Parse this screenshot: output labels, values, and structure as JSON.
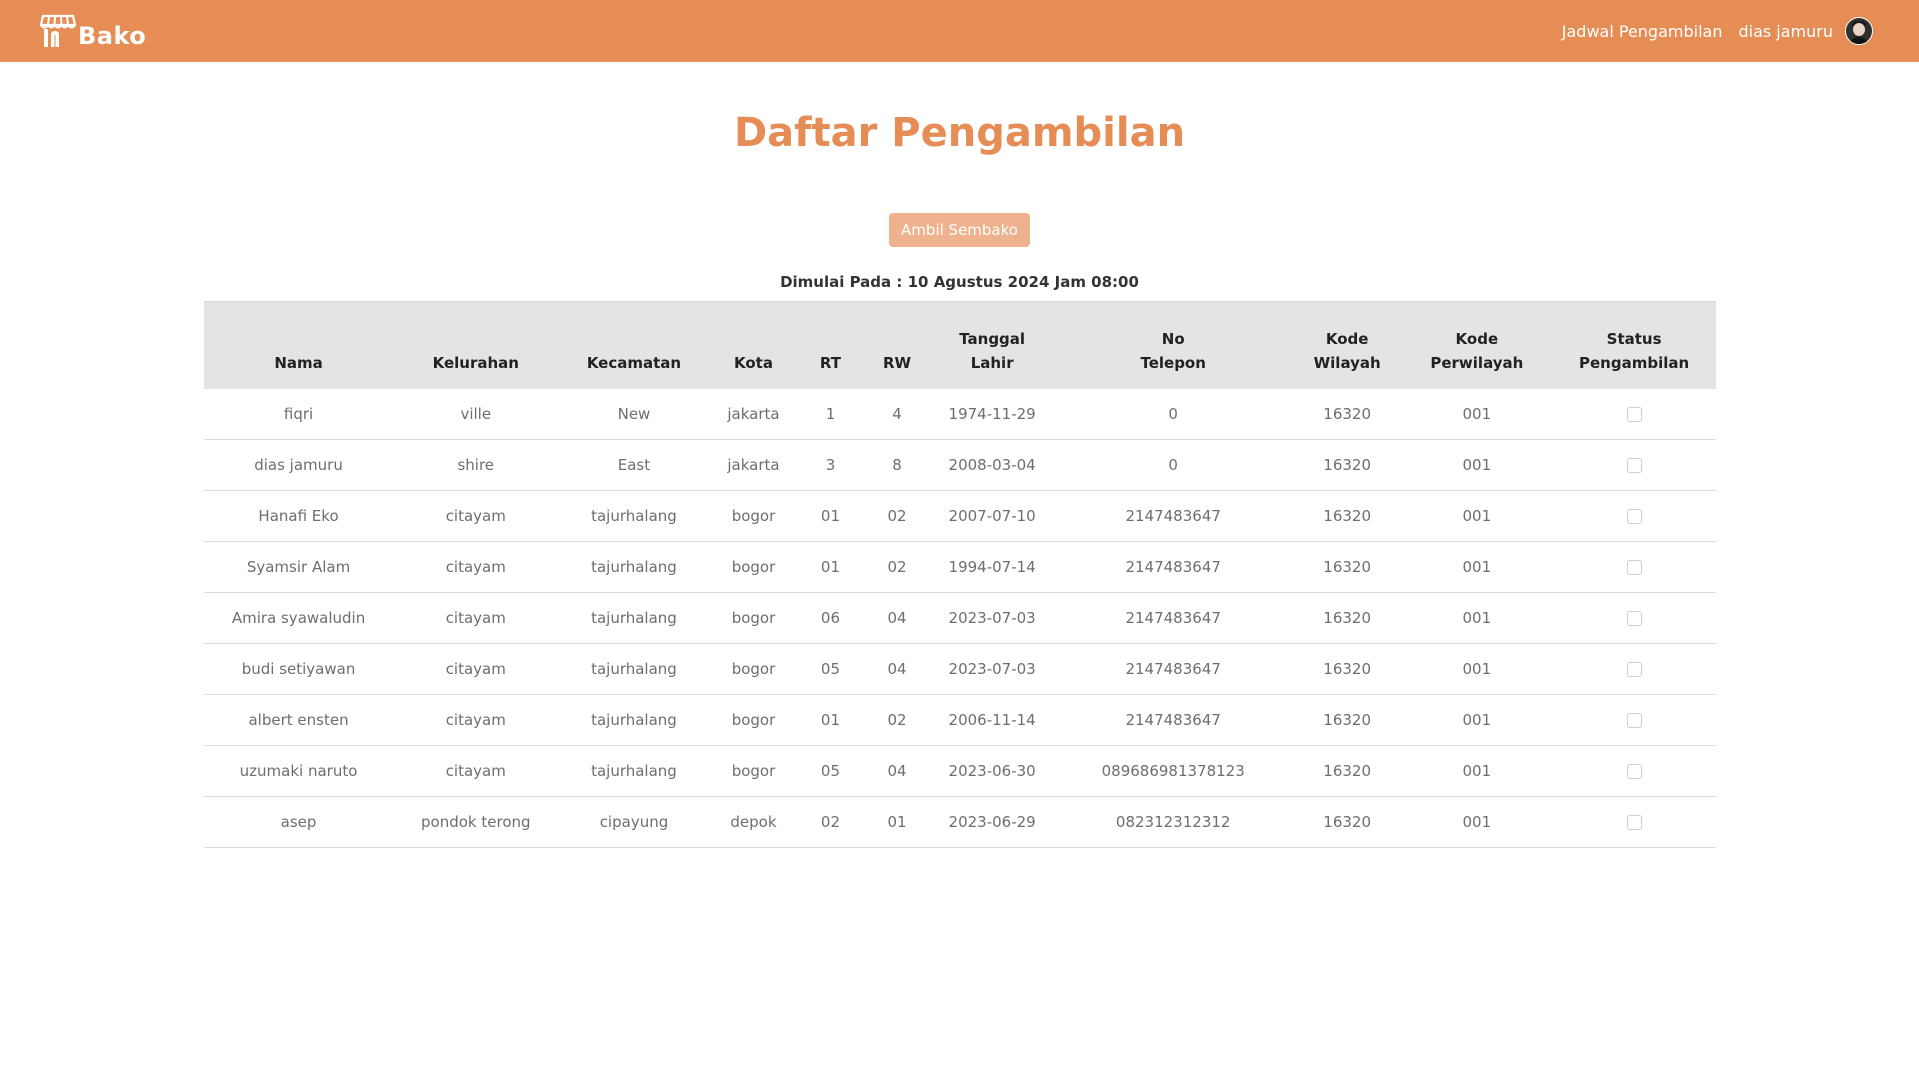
{
  "navbar": {
    "brand": "Bako",
    "logo_icon": "storefront-icon",
    "schedule_link": "Jadwal Pengambilan",
    "user_name": "dias jamuru",
    "bg_color": "#E58D55"
  },
  "main": {
    "title": "Daftar Pengambilan",
    "button_label": "Ambil Sembako",
    "start_info": "Dimulai Pada : 10 Agustus 2024 Jam 08:00"
  },
  "table": {
    "headers": [
      [
        "Nama"
      ],
      [
        "Kelurahan"
      ],
      [
        "Kecamatan"
      ],
      [
        "Kota"
      ],
      [
        "RT"
      ],
      [
        "RW"
      ],
      [
        "Tanggal",
        "Lahir"
      ],
      [
        "No",
        "Telepon"
      ],
      [
        "Kode",
        "Wilayah"
      ],
      [
        "Kode",
        "Perwilayah"
      ],
      [
        "Status",
        "Pengambilan"
      ]
    ],
    "rows": [
      {
        "nama": "fiqri",
        "kelurahan": "ville",
        "kecamatan": "New",
        "kota": "jakarta",
        "rt": "1",
        "rw": "4",
        "tgl": "1974-11-29",
        "telp": "0",
        "kode_wilayah": "16320",
        "kode_perwilayah": "001",
        "status": false
      },
      {
        "nama": "dias jamuru",
        "kelurahan": "shire",
        "kecamatan": "East",
        "kota": "jakarta",
        "rt": "3",
        "rw": "8",
        "tgl": "2008-03-04",
        "telp": "0",
        "kode_wilayah": "16320",
        "kode_perwilayah": "001",
        "status": false
      },
      {
        "nama": "Hanafi Eko",
        "kelurahan": "citayam",
        "kecamatan": "tajurhalang",
        "kota": "bogor",
        "rt": "01",
        "rw": "02",
        "tgl": "2007-07-10",
        "telp": "2147483647",
        "kode_wilayah": "16320",
        "kode_perwilayah": "001",
        "status": false
      },
      {
        "nama": "Syamsir Alam",
        "kelurahan": "citayam",
        "kecamatan": "tajurhalang",
        "kota": "bogor",
        "rt": "01",
        "rw": "02",
        "tgl": "1994-07-14",
        "telp": "2147483647",
        "kode_wilayah": "16320",
        "kode_perwilayah": "001",
        "status": false
      },
      {
        "nama": "Amira syawaludin",
        "kelurahan": "citayam",
        "kecamatan": "tajurhalang",
        "kota": "bogor",
        "rt": "06",
        "rw": "04",
        "tgl": "2023-07-03",
        "telp": "2147483647",
        "kode_wilayah": "16320",
        "kode_perwilayah": "001",
        "status": false
      },
      {
        "nama": "budi setiyawan",
        "kelurahan": "citayam",
        "kecamatan": "tajurhalang",
        "kota": "bogor",
        "rt": "05",
        "rw": "04",
        "tgl": "2023-07-03",
        "telp": "2147483647",
        "kode_wilayah": "16320",
        "kode_perwilayah": "001",
        "status": false
      },
      {
        "nama": "albert ensten",
        "kelurahan": "citayam",
        "kecamatan": "tajurhalang",
        "kota": "bogor",
        "rt": "01",
        "rw": "02",
        "tgl": "2006-11-14",
        "telp": "2147483647",
        "kode_wilayah": "16320",
        "kode_perwilayah": "001",
        "status": false
      },
      {
        "nama": "uzumaki naruto",
        "kelurahan": "citayam",
        "kecamatan": "tajurhalang",
        "kota": "bogor",
        "rt": "05",
        "rw": "04",
        "tgl": "2023-06-30",
        "telp": "089686981378123",
        "kode_wilayah": "16320",
        "kode_perwilayah": "001",
        "status": false
      },
      {
        "nama": "asep",
        "kelurahan": "pondok terong",
        "kecamatan": "cipayung",
        "kota": "depok",
        "rt": "02",
        "rw": "01",
        "tgl": "2023-06-29",
        "telp": "082312312312",
        "kode_wilayah": "16320",
        "kode_perwilayah": "001",
        "status": false
      }
    ]
  }
}
